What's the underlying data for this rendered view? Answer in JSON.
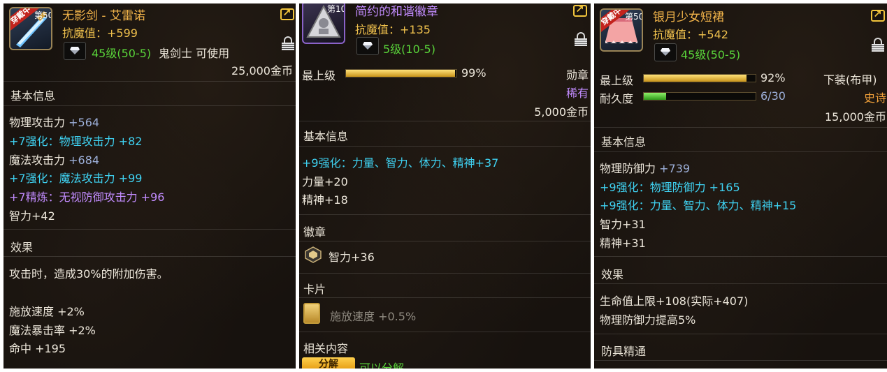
{
  "panels": [
    {
      "badge": "穿戴中",
      "level_badge": "第50",
      "name": "无影剑 - 艾雷诺",
      "resist": "抗魔值：+599",
      "level_req": "45级(50-5)",
      "class_req": "鬼剑士 可使用",
      "price": "25,000金币",
      "basic_title": "基本信息",
      "stats": [
        {
          "label": "物理攻击力",
          "value": " +564"
        },
        {
          "label": "+7强化：物理攻击力 +82"
        },
        {
          "label": "魔法攻击力",
          "value": " +684"
        },
        {
          "label": "+7强化：魔法攻击力 +99"
        },
        {
          "label": "+7精炼：无视防御攻击力 +96"
        },
        {
          "label": "智力+42"
        }
      ],
      "effect_title": "效果",
      "effect_text": "攻击时，造成30%的附加伤害。",
      "extras": [
        "施放速度 +2%",
        "魔法暴击率 +2%",
        "命中 +195"
      ]
    },
    {
      "level_badge": "第10",
      "name": "简约的和谐徽章",
      "resist": "抗魔值：+135",
      "level_req": "5级(10-5)",
      "grade_label": "最上级",
      "grade_percent": "99%",
      "grade_fill": 0.99,
      "type": "勋章",
      "rarity": "稀有",
      "price": "5,000金币",
      "basic_title": "基本信息",
      "stats": [
        {
          "label": "+9强化：力量、智力、体力、精神+37"
        },
        {
          "label": "力量+20"
        },
        {
          "label": "精神+18"
        }
      ],
      "emblem_title": "徽章",
      "emblem_text": "智力+36",
      "card_title": "卡片",
      "card_text": "施放速度 +0.5%",
      "related_title": "相关内容",
      "related_button": "分解",
      "related_text": "可以分解"
    },
    {
      "badge": "穿戴中",
      "level_badge": "第50",
      "name": "银月少女短裙",
      "resist": "抗魔值：+542",
      "level_req": "45级(50-5)",
      "grade_label": "最上级",
      "grade_percent": "92%",
      "grade_fill": 0.92,
      "durability_label": "耐久度",
      "durability": "6/30",
      "durability_fill": 0.2,
      "type": "下装(布甲)",
      "rarity": "史诗",
      "price": "15,000金币",
      "basic_title": "基本信息",
      "stats": [
        {
          "label": "物理防御力",
          "value": " +739"
        },
        {
          "label": "+9强化：物理防御力 +165"
        },
        {
          "label": "+9强化：力量、智力、体力、精神+15"
        },
        {
          "label": "智力+31"
        },
        {
          "label": "精神+31"
        }
      ],
      "effect_title": "效果",
      "effects": [
        "生命值上限+108(实际+407)",
        "物理防御力提高5%"
      ],
      "mastery_title": "防具精通"
    }
  ],
  "colors": {
    "item_name_orange": "#f2b44a",
    "item_name_purple": "#c28cff",
    "enhance_cyan": "#3fd2f2",
    "level_green": "#59d43a",
    "epic_orange": "#f2a13a"
  }
}
